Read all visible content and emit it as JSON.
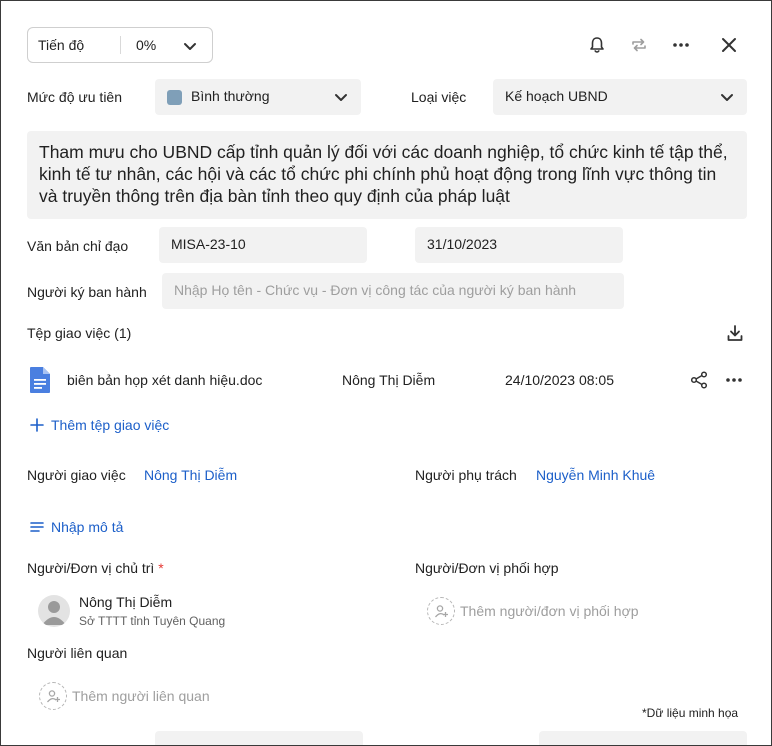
{
  "header": {
    "progress_label": "Tiến độ",
    "progress_value": "0%"
  },
  "priority": {
    "label": "Mức độ ưu tiên",
    "value": "Bình thường",
    "color": "#7f9fb8"
  },
  "task_type": {
    "label": "Loại việc",
    "value": "Kế hoạch UBND"
  },
  "description": "Tham mưu cho UBND cấp tỉnh quản lý đối với các doanh nghiệp, tổ chức kinh tế tập thể, kinh tế tư nhân, các hội và các tổ chức phi chính phủ hoạt động trong lĩnh vực thông tin và truyền thông trên địa bàn tỉnh theo quy định của pháp luật",
  "directive_doc": {
    "label": "Văn bản chỉ đạo",
    "number": "MISA-23-10",
    "date": "31/10/2023"
  },
  "signer": {
    "label": "Người ký ban hành",
    "placeholder": "Nhập Họ tên - Chức vụ - Đơn vị công tác của người ký ban hành"
  },
  "attachments": {
    "title": "Tệp giao việc (1)",
    "files": [
      {
        "name": "biên bản họp xét danh hiệu.doc",
        "uploader": "Nông Thị Diễm",
        "datetime": "24/10/2023 08:05"
      }
    ],
    "add_label": "Thêm tệp giao việc"
  },
  "assigner": {
    "label": "Người giao việc",
    "value": "Nông Thị Diễm"
  },
  "owner": {
    "label": "Người phụ trách",
    "value": "Nguyễn Minh Khuê"
  },
  "add_description_label": "Nhập mô tả",
  "host": {
    "label": "Người/Đơn vị chủ trì",
    "required_mark": "*",
    "name": "Nông Thị Diễm",
    "unit": "Sở TTTT tỉnh Tuyên Quang"
  },
  "coordinator": {
    "label": "Người/Đơn vị phối hợp",
    "add_label": "Thêm người/đơn vị phối hợp"
  },
  "related": {
    "label": "Người liên quan",
    "add_label": "Thêm người liên quan"
  },
  "footnote": "*Dữ liệu minh họa",
  "colors": {
    "link": "#1c5fc9",
    "field_bg": "#f2f2f2",
    "doc_icon": "#4a7fe0"
  }
}
